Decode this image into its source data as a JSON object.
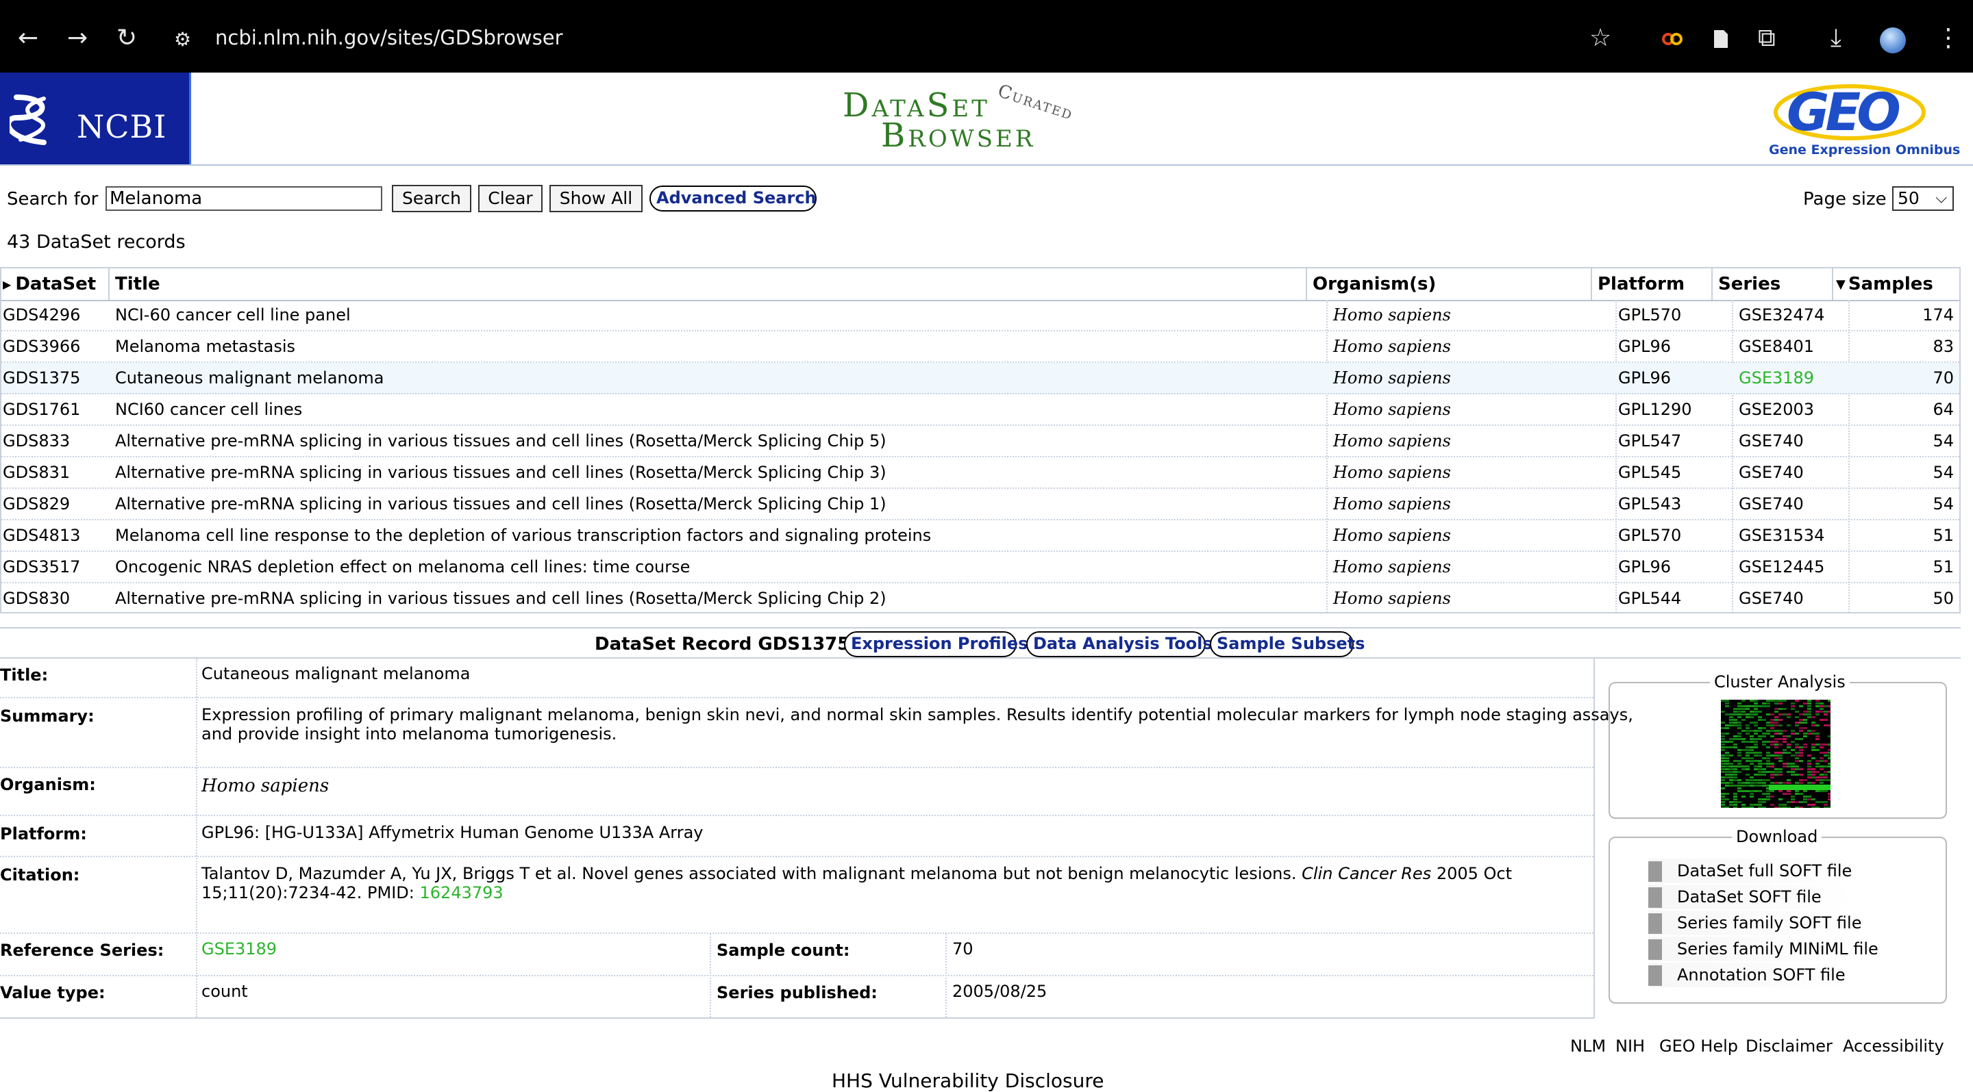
{
  "browser": {
    "url": "ncbi.nlm.nih.gov/sites/GDSbrowser",
    "icons": [
      "back-icon",
      "forward-icon",
      "reload-icon",
      "site-info-icon",
      "star-icon",
      "extension-icon",
      "reader-icon",
      "puzzle-icon",
      "download-icon",
      "profile-avatar",
      "menu-icon"
    ]
  },
  "header": {
    "ncbi": "NCBI",
    "dataset_line1": "DataSet",
    "dataset_line2": "Browser",
    "curated": "Curated",
    "geo_caption": "Gene Expression Omnibus"
  },
  "search": {
    "label": "Search for",
    "value": "Melanoma",
    "search_btn": "Search",
    "clear_btn": "Clear",
    "showall_btn": "Show All",
    "advanced_btn": "Advanced Search",
    "pagesize_label": "Page size",
    "pagesize_value": "50"
  },
  "records_count": "43 DataSet records",
  "table": {
    "headers": {
      "dataset": "DataSet",
      "title": "Title",
      "organism": "Organism(s)",
      "platform": "Platform",
      "series": "Series",
      "samples": "Samples"
    },
    "rows": [
      {
        "dataset": "GDS4296",
        "title": "NCI-60 cancer cell line panel",
        "organism": "Homo sapiens",
        "platform": "GPL570",
        "series": "GSE32474",
        "samples": "174"
      },
      {
        "dataset": "GDS3966",
        "title": "Melanoma metastasis",
        "organism": "Homo sapiens",
        "platform": "GPL96",
        "series": "GSE8401",
        "samples": "83"
      },
      {
        "dataset": "GDS1375",
        "title": "Cutaneous malignant melanoma",
        "organism": "Homo sapiens",
        "platform": "GPL96",
        "series": "GSE3189",
        "samples": "70"
      },
      {
        "dataset": "GDS1761",
        "title": "NCI60 cancer cell lines",
        "organism": "Homo sapiens",
        "platform": "GPL1290",
        "series": "GSE2003",
        "samples": "64"
      },
      {
        "dataset": "GDS833",
        "title": "Alternative pre-mRNA splicing in various tissues and cell lines (Rosetta/Merck Splicing Chip 5)",
        "organism": "Homo sapiens",
        "platform": "GPL547",
        "series": "GSE740",
        "samples": "54"
      },
      {
        "dataset": "GDS831",
        "title": "Alternative pre-mRNA splicing in various tissues and cell lines (Rosetta/Merck Splicing Chip 3)",
        "organism": "Homo sapiens",
        "platform": "GPL545",
        "series": "GSE740",
        "samples": "54"
      },
      {
        "dataset": "GDS829",
        "title": "Alternative pre-mRNA splicing in various tissues and cell lines (Rosetta/Merck Splicing Chip 1)",
        "organism": "Homo sapiens",
        "platform": "GPL543",
        "series": "GSE740",
        "samples": "54"
      },
      {
        "dataset": "GDS4813",
        "title": "Melanoma cell line response to the depletion of various transcription factors and signaling proteins",
        "organism": "Homo sapiens",
        "platform": "GPL570",
        "series": "GSE31534",
        "samples": "51"
      },
      {
        "dataset": "GDS3517",
        "title": "Oncogenic NRAS depletion effect on melanoma cell lines: time course",
        "organism": "Homo sapiens",
        "platform": "GPL96",
        "series": "GSE12445",
        "samples": "51"
      },
      {
        "dataset": "GDS830",
        "title": "Alternative pre-mRNA splicing in various tissues and cell lines (Rosetta/Merck Splicing Chip 2)",
        "organism": "Homo sapiens",
        "platform": "GPL544",
        "series": "GSE740",
        "samples": "50"
      }
    ]
  },
  "record": {
    "heading": "DataSet Record GDS1375:",
    "tab_expression": "Expression Profiles",
    "tab_analysis": "Data Analysis Tools",
    "tab_subsets": "Sample Subsets",
    "labels": {
      "title": "Title:",
      "summary": "Summary:",
      "organism": "Organism:",
      "platform": "Platform:",
      "citation": "Citation:",
      "ref_series": "Reference Series:",
      "sample_count": "Sample count:",
      "value_type": "Value type:",
      "series_published": "Series published:"
    },
    "title": "Cutaneous malignant melanoma",
    "summary_line1": "Expression profiling of primary malignant melanoma, benign skin nevi, and normal skin samples. Results identify potential molecular markers for lymph node staging assays,",
    "summary_line2": "and provide insight into melanoma tumorigenesis.",
    "organism": "Homo sapiens",
    "platform": "GPL96: [HG-U133A] Affymetrix Human Genome U133A Array",
    "citation_text": "Talantov D, Mazumder A, Yu JX, Briggs T et al. Novel genes associated with malignant melanoma but not benign melanocytic lesions.",
    "citation_journal": "Clin Cancer Res",
    "citation_date": "2005 Oct",
    "citation_line2": "15;11(20):7234-42. PMID:",
    "pmid": "16243793",
    "ref_series": "GSE3189",
    "sample_count": "70",
    "value_type": "count",
    "series_published": "2005/08/25"
  },
  "side": {
    "cluster_legend": "Cluster Analysis",
    "download_legend": "Download",
    "downloads": [
      "DataSet full SOFT file",
      "DataSet SOFT file",
      "Series family SOFT file",
      "Series family MINiML file",
      "Annotation SOFT file"
    ]
  },
  "footer": {
    "links": [
      "NLM",
      "NIH",
      "GEO Help",
      "Disclaimer",
      "Accessibility"
    ],
    "hhs": "HHS Vulnerability Disclosure"
  },
  "colors": {
    "ncbi_blue": "#10229a",
    "link_green": "#2bb52b",
    "pill_text": "#142b8e",
    "dataset_browser_green": "#2f7a24"
  }
}
